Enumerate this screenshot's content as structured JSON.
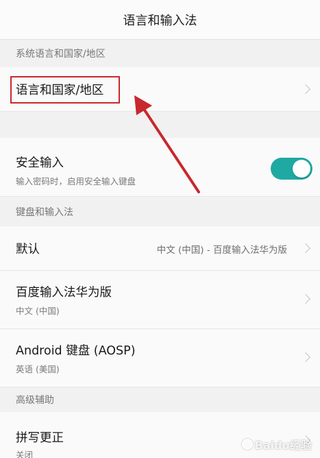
{
  "header": {
    "title": "语言和输入法"
  },
  "sections": {
    "system_language": {
      "header": "系统语言和国家/地区",
      "item_label": "语言和国家/地区"
    },
    "secure_input": {
      "label": "安全输入",
      "subtitle": "输入密码时，启用安全输入键盘",
      "enabled": true,
      "accent_color": "#1fa9a3"
    },
    "keyboard": {
      "header": "键盘和输入法",
      "items": [
        {
          "label": "默认",
          "value": "中文 (中国) - 百度输入法华为版"
        },
        {
          "label": "百度输入法华为版",
          "subtitle": "中文 (中国)"
        },
        {
          "label": "Android 键盘 (AOSP)",
          "subtitle": "英语 (美国)"
        }
      ]
    },
    "advanced": {
      "header": "高级辅助",
      "items": [
        {
          "label": "拼写更正",
          "subtitle": "关闭"
        }
      ]
    }
  },
  "annotation": {
    "color": "#c8282e",
    "type": "arrow-and-box"
  },
  "watermark": {
    "text": "Baidu经验",
    "icon": "paw-icon"
  },
  "icons": {
    "chevron": "chevron-right-icon"
  }
}
